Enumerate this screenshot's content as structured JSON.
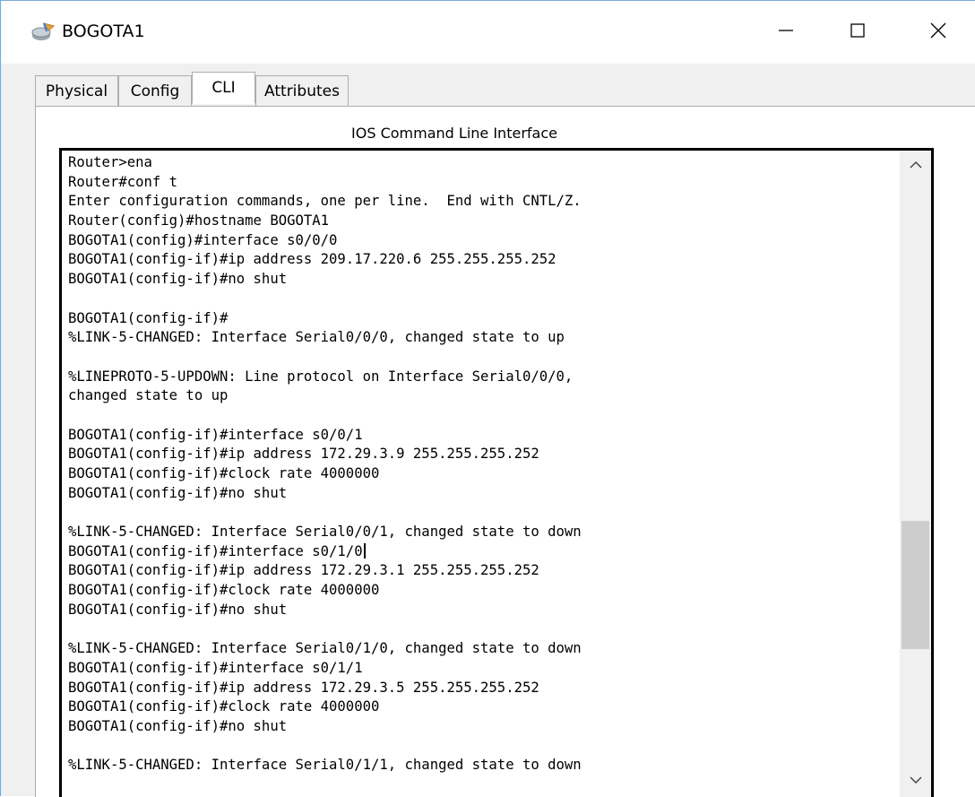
{
  "window": {
    "title": "BOGOTA1",
    "icon": "router-icon",
    "controls": [
      "minimize-icon",
      "maximize-icon",
      "close-icon"
    ]
  },
  "tabs": [
    {
      "label": "Physical",
      "active": false
    },
    {
      "label": "Config",
      "active": false
    },
    {
      "label": "CLI",
      "active": true
    },
    {
      "label": "Attributes",
      "active": false
    }
  ],
  "cli": {
    "panel_title": "IOS Command Line Interface",
    "lines": [
      "Router>ena",
      "Router#conf t",
      "Enter configuration commands, one per line.  End with CNTL/Z.",
      "Router(config)#hostname BOGOTA1",
      "BOGOTA1(config)#interface s0/0/0",
      "BOGOTA1(config-if)#ip address 209.17.220.6 255.255.255.252",
      "BOGOTA1(config-if)#no shut",
      "",
      "BOGOTA1(config-if)#",
      "%LINK-5-CHANGED: Interface Serial0/0/0, changed state to up",
      "",
      "%LINEPROTO-5-UPDOWN: Line protocol on Interface Serial0/0/0,",
      "changed state to up",
      "",
      "BOGOTA1(config-if)#interface s0/0/1",
      "BOGOTA1(config-if)#ip address 172.29.3.9 255.255.255.252",
      "BOGOTA1(config-if)#clock rate 4000000",
      "BOGOTA1(config-if)#no shut",
      "",
      "%LINK-5-CHANGED: Interface Serial0/0/1, changed state to down",
      "BOGOTA1(config-if)#interface s0/1/0",
      "BOGOTA1(config-if)#ip address 172.29.3.1 255.255.255.252",
      "BOGOTA1(config-if)#clock rate 4000000",
      "BOGOTA1(config-if)#no shut",
      "",
      "%LINK-5-CHANGED: Interface Serial0/1/0, changed state to down",
      "BOGOTA1(config-if)#interface s0/1/1",
      "BOGOTA1(config-if)#ip address 172.29.3.5 255.255.255.252",
      "BOGOTA1(config-if)#clock rate 4000000",
      "BOGOTA1(config-if)#no shut",
      "",
      "%LINK-5-CHANGED: Interface Serial0/1/1, changed state to down"
    ],
    "cursor_line_index": 20,
    "scroll_position_fraction": 0.75
  }
}
